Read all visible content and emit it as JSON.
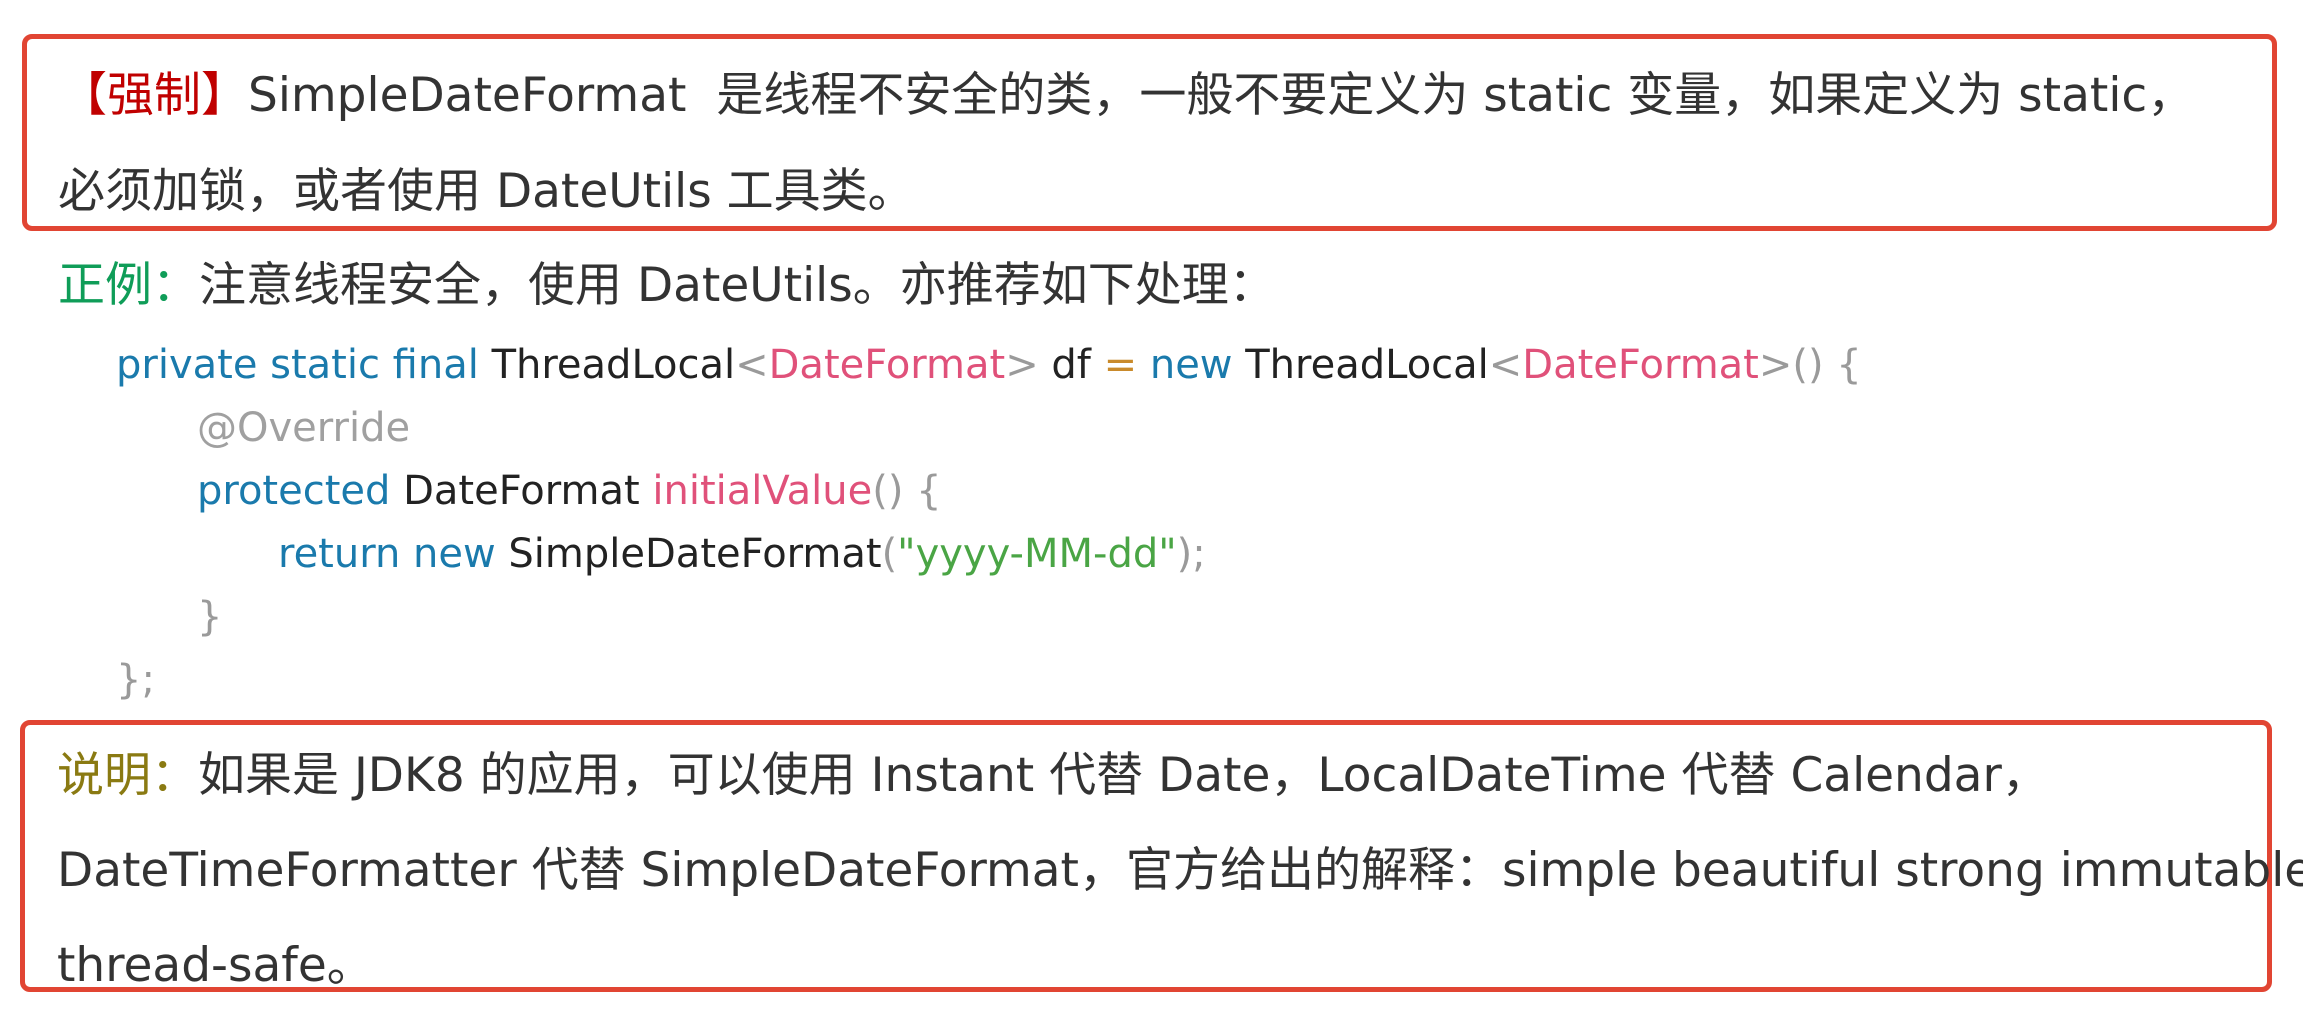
{
  "rule": {
    "tag": "【强制】",
    "line1": "SimpleDateFormat  是线程不安全的类，一般不要定义为 static 变量，如果定义为 static，",
    "line2": "必须加锁，或者使用 DateUtils 工具类。"
  },
  "example": {
    "tag": "正例：",
    "text": "注意线程安全，使用 DateUtils。亦推荐如下处理："
  },
  "code": {
    "l1": {
      "k1": "private static final",
      "t1": " ThreadLocal",
      "lt1": "<",
      "g1": "DateFormat",
      "gt1": ">",
      "v1": " df ",
      "eq": "=",
      "sp": " ",
      "k2": "new",
      "t2": " ThreadLocal",
      "lt2": "<",
      "g2": "DateFormat",
      "gt2": ">",
      "p1": "() {"
    },
    "l2": {
      "ann": "@Override"
    },
    "l3": {
      "k1": "protected",
      "t1": " DateFormat ",
      "m1": "initialValue",
      "p1": "() {"
    },
    "l4": {
      "k1": "return new",
      "t1": " SimpleDateFormat",
      "p1": "(",
      "s1": "\"yyyy-MM-dd\"",
      "p2": ");"
    },
    "l5": {
      "p1": "}"
    },
    "l6": {
      "p1": "};"
    }
  },
  "note": {
    "tag": "说明：",
    "line1": "如果是 JDK8 的应用，可以使用 Instant 代替 Date，LocalDateTime 代替 Calendar，",
    "line2": "DateTimeFormatter 代替 SimpleDateFormat，官方给出的解释：simple beautiful strong immutable",
    "line3": "thread-safe。"
  },
  "colors": {
    "box_border": "#e14533",
    "tag_red": "#c00000",
    "tag_green": "#0f9d58",
    "tag_olive": "#8a7a12",
    "keyword": "#1a7aac",
    "generic": "#e0517a",
    "string": "#4aa545"
  }
}
